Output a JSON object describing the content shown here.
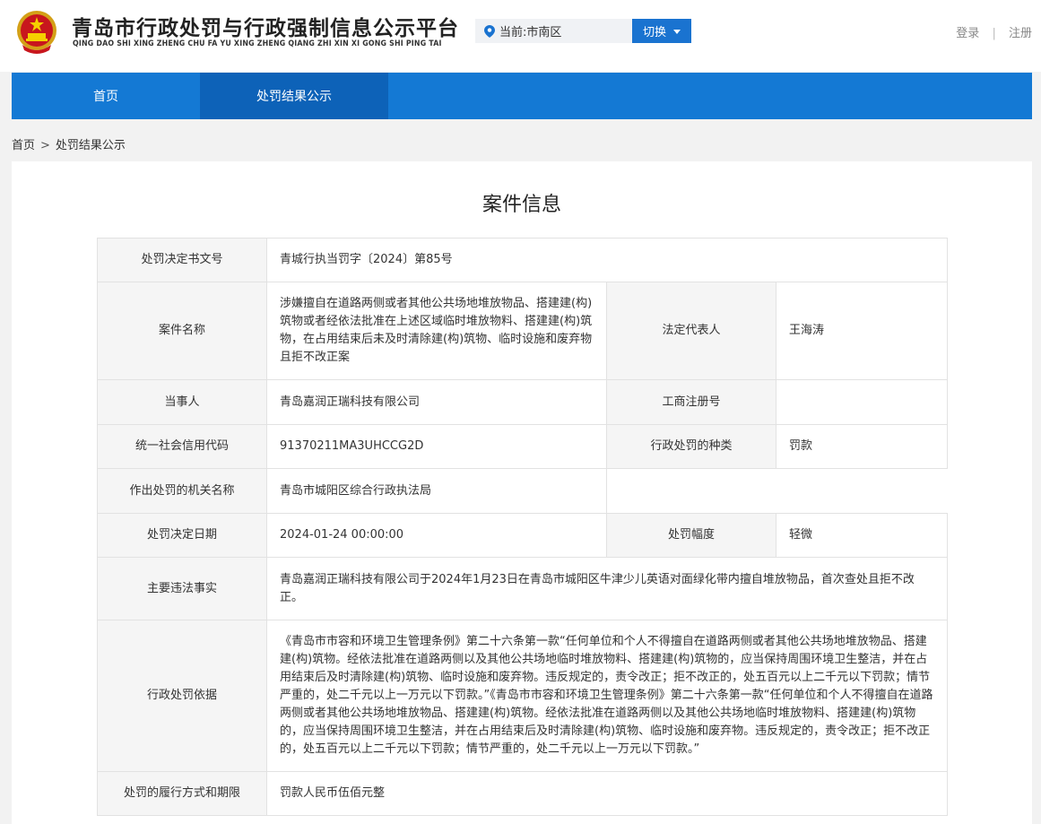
{
  "header": {
    "title": "青岛市行政处罚与行政强制信息公示平台",
    "pinyin": "QING DAO SHI XING ZHENG CHU FA YU XING ZHENG QIANG ZHI XIN XI GONG SHI PING TAI",
    "emblem_icon": "national-emblem-icon",
    "region_label": "当前:市南区",
    "switch_label": "切换",
    "login_label": "登录",
    "auth_sep": "|",
    "register_label": "注册"
  },
  "nav": {
    "items": [
      {
        "label": "首页",
        "active": false
      },
      {
        "label": "处罚结果公示",
        "active": true
      }
    ]
  },
  "breadcrumb": {
    "home": "首页",
    "sep": ">",
    "current": "处罚结果公示"
  },
  "panel": {
    "title": "案件信息"
  },
  "case": {
    "doc_no_label": "处罚决定书文号",
    "doc_no": "青城行执当罚字〔2024〕第85号",
    "case_name_label": "案件名称",
    "case_name": "涉嫌擅自在道路两侧或者其他公共场地堆放物品、搭建建(构)筑物或者经依法批准在上述区域临时堆放物料、搭建建(构)筑物，在占用结束后未及时清除建(构)筑物、临时设施和废弃物且拒不改正案",
    "legal_rep_label": "法定代表人",
    "legal_rep": "王海涛",
    "party_label": "当事人",
    "party": "青岛嘉润正瑞科技有限公司",
    "biz_reg_label": "工商注册号",
    "biz_reg": "",
    "credit_code_label": "统一社会信用代码",
    "credit_code": "91370211MA3UHCCG2D",
    "penalty_type_label": "行政处罚的种类",
    "penalty_type": "罚款",
    "authority_label": "作出处罚的机关名称",
    "authority": "青岛市城阳区综合行政执法局",
    "decision_date_label": "处罚决定日期",
    "decision_date": "2024-01-24 00:00:00",
    "range_label": "处罚幅度",
    "range": "轻微",
    "facts_label": "主要违法事实",
    "facts": "青岛嘉润正瑞科技有限公司于2024年1月23日在青岛市城阳区牛津少儿英语对面绿化带内擅自堆放物品，首次查处且拒不改正。",
    "basis_label": "行政处罚依据",
    "basis": "《青岛市市容和环境卫生管理条例》第二十六条第一款“任何单位和个人不得擅自在道路两侧或者其他公共场地堆放物品、搭建建(构)筑物。经依法批准在道路两侧以及其他公共场地临时堆放物料、搭建建(构)筑物的，应当保持周围环境卫生整洁，并在占用结束后及时清除建(构)筑物、临时设施和废弃物。违反规定的，责令改正；拒不改正的，处五百元以上二千元以下罚款；情节严重的，处二千元以上一万元以下罚款。”《青岛市市容和环境卫生管理条例》第二十六条第一款“任何单位和个人不得擅自在道路两侧或者其他公共场地堆放物品、搭建建(构)筑物。经依法批准在道路两侧以及其他公共场地临时堆放物料、搭建建(构)筑物的，应当保持周围环境卫生整洁，并在占用结束后及时清除建(构)筑物、临时设施和废弃物。违反规定的，责令改正；拒不改正的，处五百元以上二千元以下罚款；情节严重的，处二千元以上一万元以下罚款。”",
    "execution_label": "处罚的履行方式和期限",
    "execution": "罚款人民币伍佰元整"
  },
  "colors": {
    "nav_bg": "#1479d4",
    "nav_active": "#0d62b8",
    "switch_bg": "#1a73d0"
  }
}
